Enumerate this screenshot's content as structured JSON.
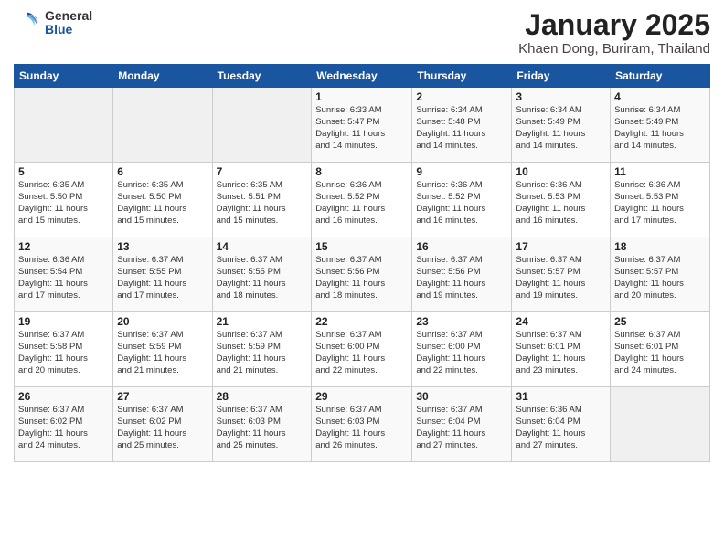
{
  "logo": {
    "general": "General",
    "blue": "Blue"
  },
  "title": "January 2025",
  "subtitle": "Khaen Dong, Buriram, Thailand",
  "days_header": [
    "Sunday",
    "Monday",
    "Tuesday",
    "Wednesday",
    "Thursday",
    "Friday",
    "Saturday"
  ],
  "weeks": [
    [
      {
        "day": "",
        "info": ""
      },
      {
        "day": "",
        "info": ""
      },
      {
        "day": "",
        "info": ""
      },
      {
        "day": "1",
        "info": "Sunrise: 6:33 AM\nSunset: 5:47 PM\nDaylight: 11 hours\nand 14 minutes."
      },
      {
        "day": "2",
        "info": "Sunrise: 6:34 AM\nSunset: 5:48 PM\nDaylight: 11 hours\nand 14 minutes."
      },
      {
        "day": "3",
        "info": "Sunrise: 6:34 AM\nSunset: 5:49 PM\nDaylight: 11 hours\nand 14 minutes."
      },
      {
        "day": "4",
        "info": "Sunrise: 6:34 AM\nSunset: 5:49 PM\nDaylight: 11 hours\nand 14 minutes."
      }
    ],
    [
      {
        "day": "5",
        "info": "Sunrise: 6:35 AM\nSunset: 5:50 PM\nDaylight: 11 hours\nand 15 minutes."
      },
      {
        "day": "6",
        "info": "Sunrise: 6:35 AM\nSunset: 5:50 PM\nDaylight: 11 hours\nand 15 minutes."
      },
      {
        "day": "7",
        "info": "Sunrise: 6:35 AM\nSunset: 5:51 PM\nDaylight: 11 hours\nand 15 minutes."
      },
      {
        "day": "8",
        "info": "Sunrise: 6:36 AM\nSunset: 5:52 PM\nDaylight: 11 hours\nand 16 minutes."
      },
      {
        "day": "9",
        "info": "Sunrise: 6:36 AM\nSunset: 5:52 PM\nDaylight: 11 hours\nand 16 minutes."
      },
      {
        "day": "10",
        "info": "Sunrise: 6:36 AM\nSunset: 5:53 PM\nDaylight: 11 hours\nand 16 minutes."
      },
      {
        "day": "11",
        "info": "Sunrise: 6:36 AM\nSunset: 5:53 PM\nDaylight: 11 hours\nand 17 minutes."
      }
    ],
    [
      {
        "day": "12",
        "info": "Sunrise: 6:36 AM\nSunset: 5:54 PM\nDaylight: 11 hours\nand 17 minutes."
      },
      {
        "day": "13",
        "info": "Sunrise: 6:37 AM\nSunset: 5:55 PM\nDaylight: 11 hours\nand 17 minutes."
      },
      {
        "day": "14",
        "info": "Sunrise: 6:37 AM\nSunset: 5:55 PM\nDaylight: 11 hours\nand 18 minutes."
      },
      {
        "day": "15",
        "info": "Sunrise: 6:37 AM\nSunset: 5:56 PM\nDaylight: 11 hours\nand 18 minutes."
      },
      {
        "day": "16",
        "info": "Sunrise: 6:37 AM\nSunset: 5:56 PM\nDaylight: 11 hours\nand 19 minutes."
      },
      {
        "day": "17",
        "info": "Sunrise: 6:37 AM\nSunset: 5:57 PM\nDaylight: 11 hours\nand 19 minutes."
      },
      {
        "day": "18",
        "info": "Sunrise: 6:37 AM\nSunset: 5:57 PM\nDaylight: 11 hours\nand 20 minutes."
      }
    ],
    [
      {
        "day": "19",
        "info": "Sunrise: 6:37 AM\nSunset: 5:58 PM\nDaylight: 11 hours\nand 20 minutes."
      },
      {
        "day": "20",
        "info": "Sunrise: 6:37 AM\nSunset: 5:59 PM\nDaylight: 11 hours\nand 21 minutes."
      },
      {
        "day": "21",
        "info": "Sunrise: 6:37 AM\nSunset: 5:59 PM\nDaylight: 11 hours\nand 21 minutes."
      },
      {
        "day": "22",
        "info": "Sunrise: 6:37 AM\nSunset: 6:00 PM\nDaylight: 11 hours\nand 22 minutes."
      },
      {
        "day": "23",
        "info": "Sunrise: 6:37 AM\nSunset: 6:00 PM\nDaylight: 11 hours\nand 22 minutes."
      },
      {
        "day": "24",
        "info": "Sunrise: 6:37 AM\nSunset: 6:01 PM\nDaylight: 11 hours\nand 23 minutes."
      },
      {
        "day": "25",
        "info": "Sunrise: 6:37 AM\nSunset: 6:01 PM\nDaylight: 11 hours\nand 24 minutes."
      }
    ],
    [
      {
        "day": "26",
        "info": "Sunrise: 6:37 AM\nSunset: 6:02 PM\nDaylight: 11 hours\nand 24 minutes."
      },
      {
        "day": "27",
        "info": "Sunrise: 6:37 AM\nSunset: 6:02 PM\nDaylight: 11 hours\nand 25 minutes."
      },
      {
        "day": "28",
        "info": "Sunrise: 6:37 AM\nSunset: 6:03 PM\nDaylight: 11 hours\nand 25 minutes."
      },
      {
        "day": "29",
        "info": "Sunrise: 6:37 AM\nSunset: 6:03 PM\nDaylight: 11 hours\nand 26 minutes."
      },
      {
        "day": "30",
        "info": "Sunrise: 6:37 AM\nSunset: 6:04 PM\nDaylight: 11 hours\nand 27 minutes."
      },
      {
        "day": "31",
        "info": "Sunrise: 6:36 AM\nSunset: 6:04 PM\nDaylight: 11 hours\nand 27 minutes."
      },
      {
        "day": "",
        "info": ""
      }
    ]
  ]
}
